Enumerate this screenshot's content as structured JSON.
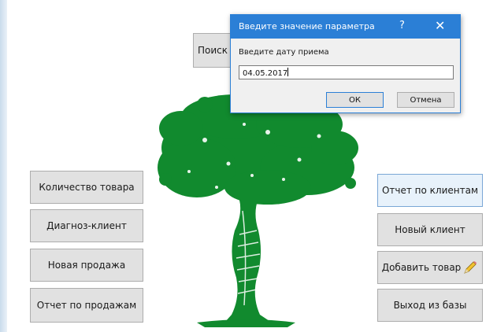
{
  "buttons": {
    "search": "Поиск",
    "product_count": "Количество товара",
    "diagnosis_client": "Диагноз-клиент",
    "new_sale": "Новая продажа",
    "sales_report": "Отчет по продажам",
    "client_report": "Отчет по клиентам",
    "new_client": "Новый клиент",
    "add_product": "Добавить товар",
    "exit_db": "Выход из базы"
  },
  "dialog": {
    "title": "Введите значение параметра",
    "help": "?",
    "close": "✕",
    "label": "Введите дату приема",
    "value": "04.05.2017",
    "ok": "ОК",
    "cancel": "Отмена"
  },
  "colors": {
    "accent": "#2b7fd6",
    "tree_green": "#118a2e"
  }
}
